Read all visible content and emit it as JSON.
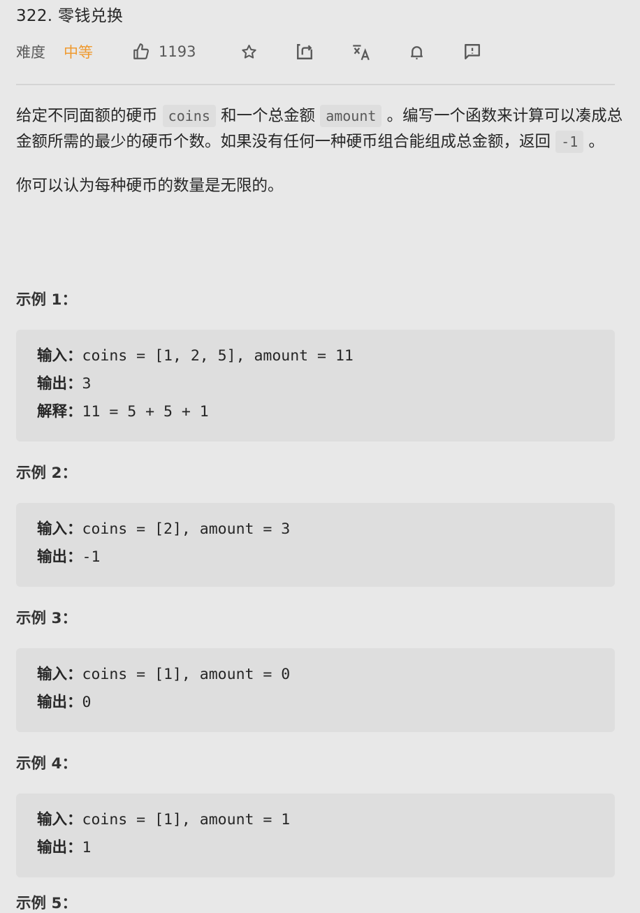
{
  "problem": {
    "title": "322. 零钱兑换",
    "difficulty_label": "难度",
    "difficulty_value": "中等",
    "difficulty_color": "#ef9a30",
    "likes": "1193"
  },
  "toolbar_icons": [
    "thumbs-up-icon",
    "star-icon",
    "share-icon",
    "translate-icon",
    "bell-icon",
    "feedback-icon"
  ],
  "description": {
    "p1_a": "给定不同面额的硬币 ",
    "p1_code1": "coins",
    "p1_b": " 和一个总金额 ",
    "p1_code2": "amount",
    "p1_c": " 。编写一个函数来计算可以凑成总金额所需的最少的硬币个数。如果没有任何一种硬币组合能组成总金额，返回 ",
    "p1_code3": "-1",
    "p1_d": " 。",
    "p2": "你可以认为每种硬币的数量是无限的。"
  },
  "examples": [
    {
      "title": "示例 1：",
      "lines": [
        {
          "key": "输入：",
          "value": "coins = [1, 2, 5], amount = 11"
        },
        {
          "key": "输出：",
          "value": "3"
        },
        {
          "key": "解释：",
          "value": "11 = 5 + 5 + 1"
        }
      ]
    },
    {
      "title": "示例 2：",
      "lines": [
        {
          "key": "输入：",
          "value": "coins = [2], amount = 3"
        },
        {
          "key": "输出：",
          "value": "-1"
        }
      ]
    },
    {
      "title": "示例 3：",
      "lines": [
        {
          "key": "输入：",
          "value": "coins = [1], amount = 0"
        },
        {
          "key": "输出：",
          "value": "0"
        }
      ]
    },
    {
      "title": "示例 4：",
      "lines": [
        {
          "key": "输入：",
          "value": "coins = [1], amount = 1"
        },
        {
          "key": "输出：",
          "value": "1"
        }
      ]
    },
    {
      "title": "示例 5："
    }
  ]
}
